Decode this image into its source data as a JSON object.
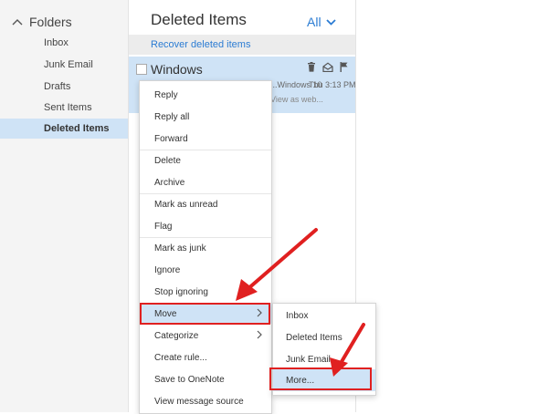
{
  "colors": {
    "accent": "#2b7cd3",
    "selection": "#cfe3f6",
    "annotation": "#e02020"
  },
  "sidebar": {
    "header": "Folders",
    "header_icon": "chevron-up-icon",
    "items": [
      {
        "label": "Inbox",
        "selected": false
      },
      {
        "label": "Junk Email",
        "selected": false
      },
      {
        "label": "Drafts",
        "selected": false
      },
      {
        "label": "Sent Items",
        "selected": false
      },
      {
        "label": "Deleted Items",
        "selected": true
      }
    ]
  },
  "list": {
    "title": "Deleted Items",
    "filter": "All",
    "filter_icon": "chevron-down-icon",
    "recover_link": "Recover deleted items",
    "message": {
      "sender": "Windows",
      "subject": "...Windows 10",
      "time": "Thu 3:13 PM",
      "preview": "View as web...",
      "icons": [
        "trash-icon",
        "envelope-open-icon",
        "flag-icon"
      ]
    }
  },
  "context_menu": {
    "items": [
      {
        "label": "Reply"
      },
      {
        "label": "Reply all"
      },
      {
        "label": "Forward"
      },
      {
        "label": "Delete"
      },
      {
        "label": "Archive"
      },
      {
        "label": "Mark as unread"
      },
      {
        "label": "Flag"
      },
      {
        "label": "Mark as junk"
      },
      {
        "label": "Ignore"
      },
      {
        "label": "Stop ignoring"
      },
      {
        "label": "Move",
        "submenu": true,
        "highlighted": true
      },
      {
        "label": "Categorize",
        "submenu": true
      },
      {
        "label": "Create rule..."
      },
      {
        "label": "Save to OneNote"
      },
      {
        "label": "View message source"
      }
    ]
  },
  "move_submenu": {
    "items": [
      {
        "label": "Inbox"
      },
      {
        "label": "Deleted Items"
      },
      {
        "label": "Junk Email"
      },
      {
        "label": "More...",
        "highlighted": true
      }
    ]
  }
}
